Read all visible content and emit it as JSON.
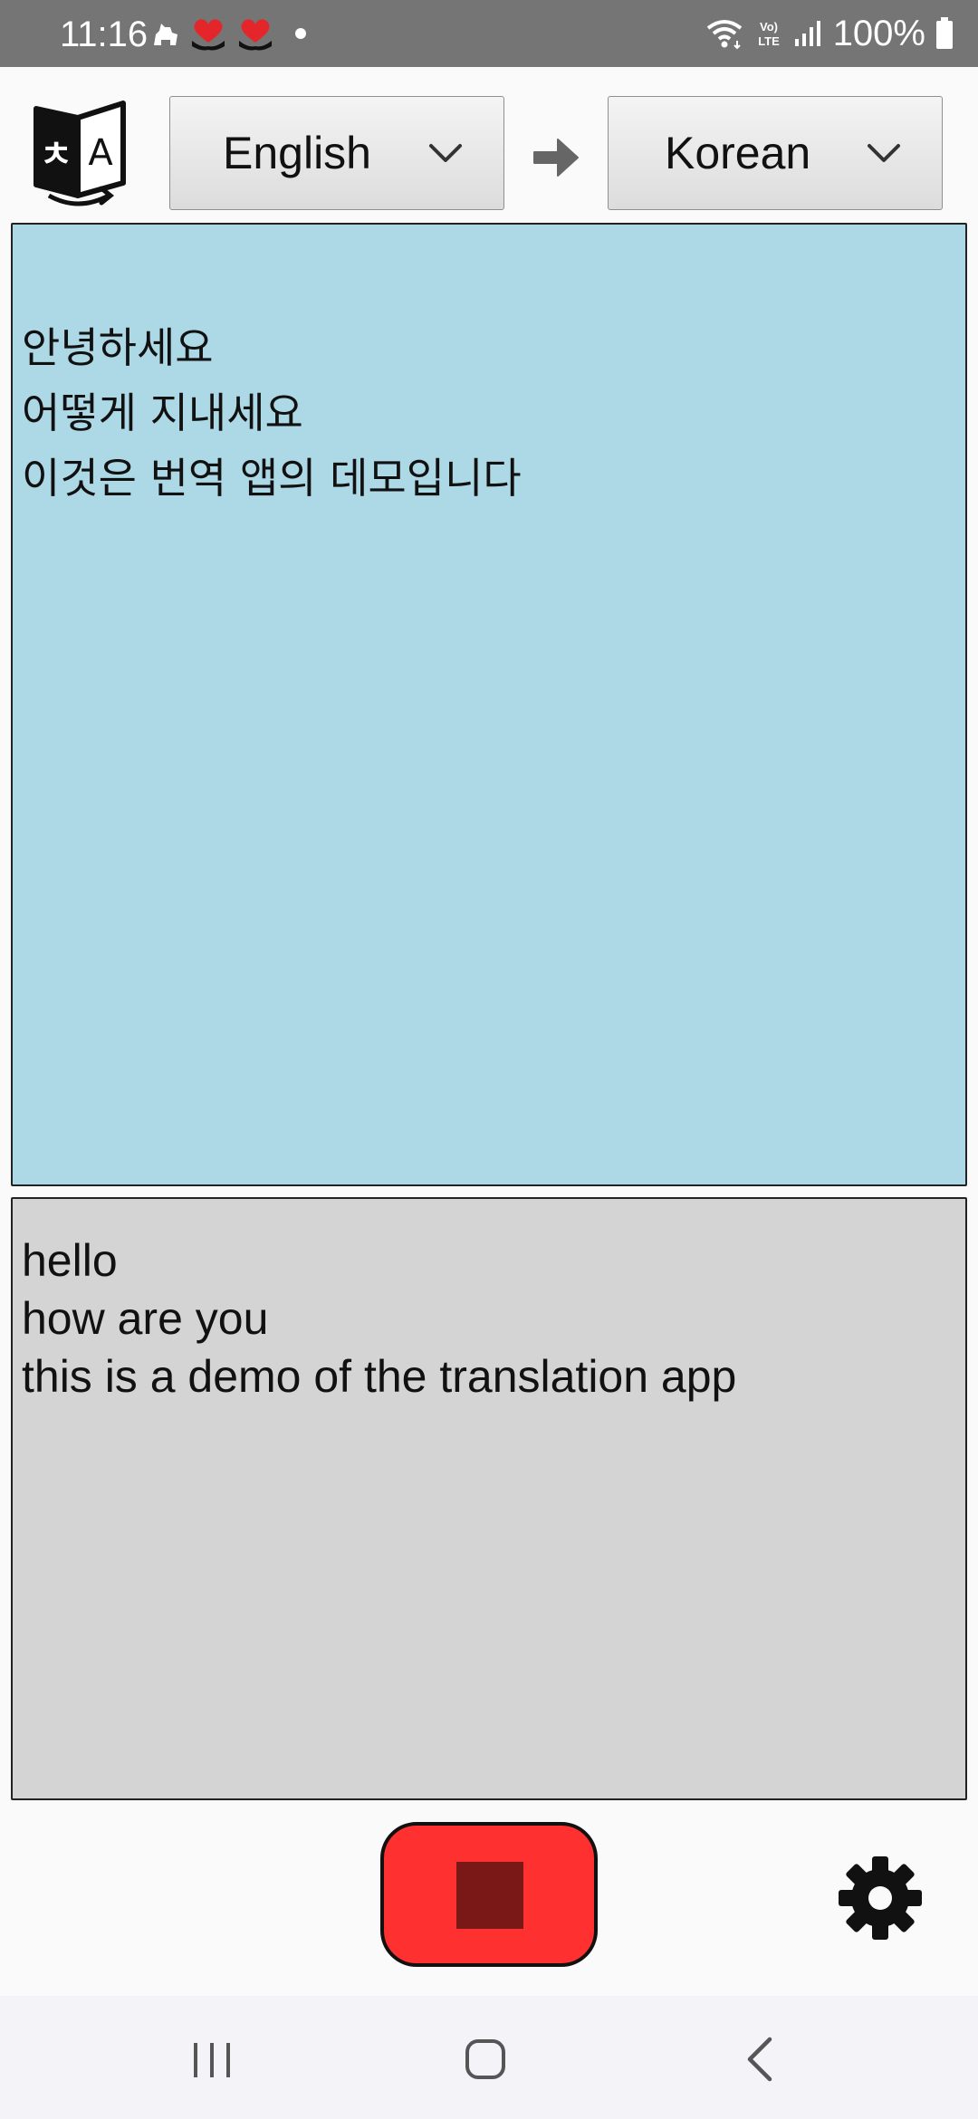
{
  "status_bar": {
    "time": "11:16",
    "battery_text": "100%",
    "icons_left": [
      "dog-icon",
      "heart-hands-icon",
      "heart-hands-icon",
      "notification-dot"
    ],
    "icons_right": [
      "wifi-icon",
      "volte-icon",
      "signal-icon",
      "battery-icon"
    ],
    "volte_label": "Vo) LTE"
  },
  "toolbar": {
    "logo_icon": "translate-logo-icon",
    "source_language": "English",
    "target_language": "Korean",
    "direction_icon": "arrow-right-icon"
  },
  "translation_panel": {
    "lines": [
      "안녕하세요",
      "어떻게 지내세요",
      "이것은 번역 앱의 데모입니다"
    ],
    "background": "#add8e6"
  },
  "source_panel": {
    "lines": [
      "hello",
      "how are you",
      "this is a demo of the translation app"
    ],
    "background": "#d4d4d4"
  },
  "controls": {
    "record_state": "recording",
    "stop_button_color": "#ff3030",
    "stop_icon_color": "#7a1818",
    "settings_icon": "gear-icon"
  },
  "nav_bar": {
    "buttons": [
      "recents-icon",
      "home-icon",
      "back-icon"
    ]
  }
}
